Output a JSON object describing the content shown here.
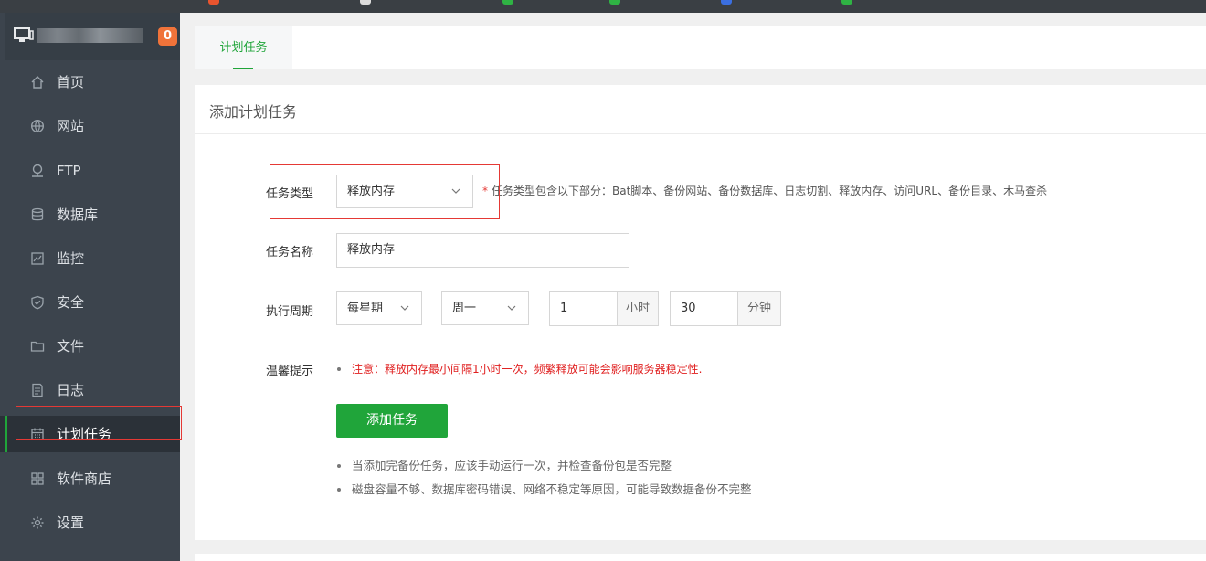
{
  "sidebar": {
    "badge": "0",
    "items": [
      {
        "label": "首页",
        "icon": "home-icon"
      },
      {
        "label": "网站",
        "icon": "globe-icon"
      },
      {
        "label": "FTP",
        "icon": "ftp-icon"
      },
      {
        "label": "数据库",
        "icon": "database-icon"
      },
      {
        "label": "监控",
        "icon": "monitor-chart-icon"
      },
      {
        "label": "安全",
        "icon": "shield-icon"
      },
      {
        "label": "文件",
        "icon": "folder-icon"
      },
      {
        "label": "日志",
        "icon": "log-icon"
      },
      {
        "label": "计划任务",
        "icon": "calendar-icon"
      },
      {
        "label": "软件商店",
        "icon": "apps-icon"
      },
      {
        "label": "设置",
        "icon": "gear-icon"
      }
    ],
    "active_index": 8
  },
  "tabs": {
    "items": [
      {
        "label": "计划任务"
      }
    ]
  },
  "panel": {
    "title": "添加计划任务"
  },
  "form": {
    "task_type": {
      "label": "任务类型",
      "value": "释放内存",
      "hint": "任务类型包含以下部分：Bat脚本、备份网站、备份数据库、日志切割、释放内存、访问URL、备份目录、木马查杀",
      "required_mark": "*"
    },
    "task_name": {
      "label": "任务名称",
      "value": "释放内存"
    },
    "period": {
      "label": "执行周期",
      "frequency": "每星期",
      "weekday": "周一",
      "hour": "1",
      "hour_unit": "小时",
      "minute": "30",
      "minute_unit": "分钟"
    },
    "tip": {
      "label": "温馨提示",
      "text": "注意：释放内存最小间隔1小时一次，频繁释放可能会影响服务器稳定性."
    },
    "submit_label": "添加任务"
  },
  "notes": [
    "当添加完备份任务，应该手动运行一次，并检查备份包是否完整",
    "磁盘容量不够、数据库密码错误、网络不稳定等原因，可能导致数据备份不完整"
  ],
  "colors": {
    "accent": "#20a53a",
    "sidebar_bg": "#3c444d",
    "warning_text": "#e02020",
    "badge": "#f0733a",
    "annotation_box": "#e53935"
  }
}
